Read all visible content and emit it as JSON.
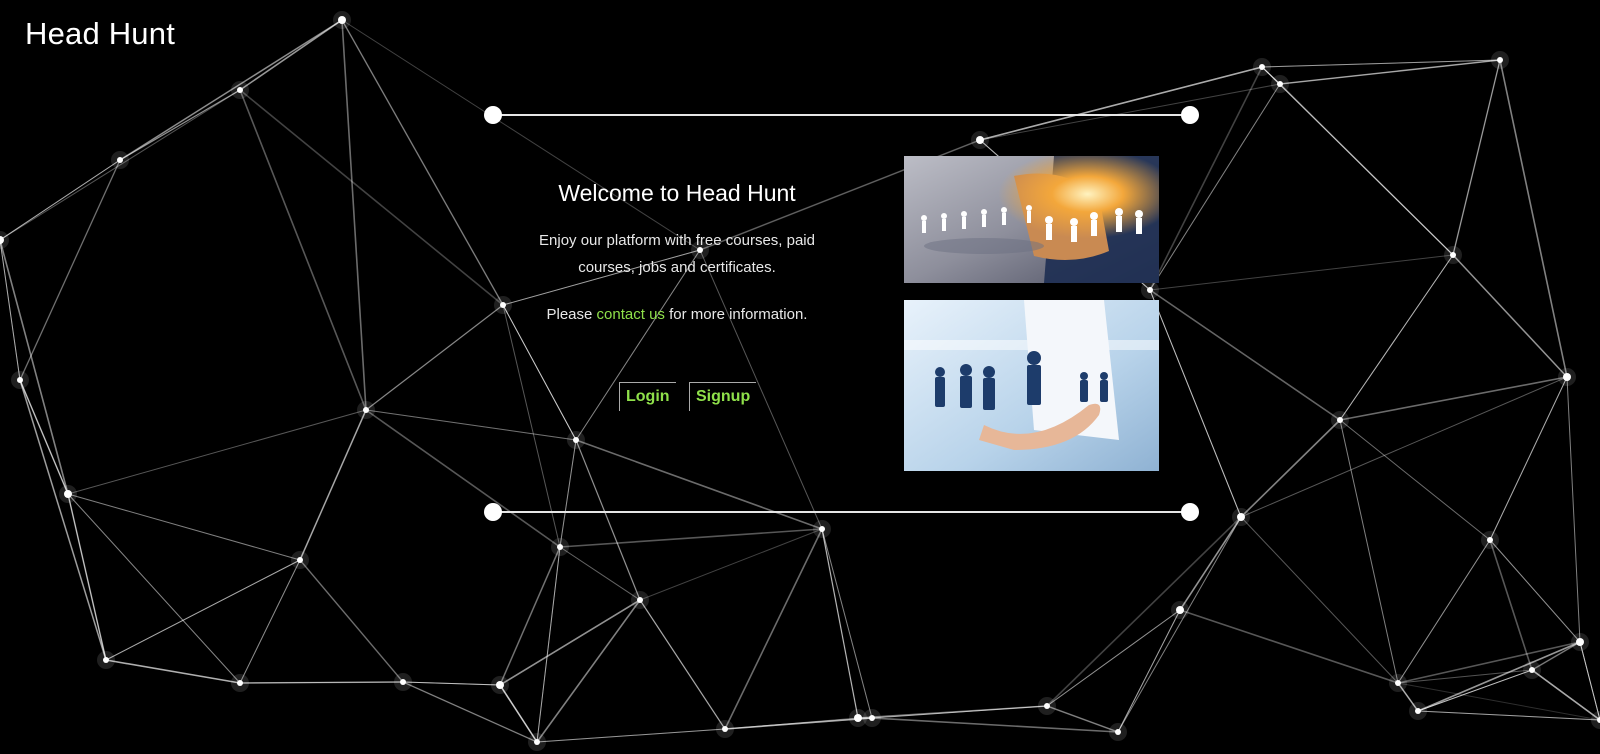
{
  "header": {
    "brand": "Head Hunt"
  },
  "intro": {
    "title": "Welcome to Head Hunt",
    "description": "Enjoy our platform with free courses, paid courses, jobs and certificates.",
    "more_prefix": "Please ",
    "contact_link": "contact us",
    "more_suffix": " for more information."
  },
  "actions": {
    "login": "Login",
    "signup": "Signup"
  },
  "images": [
    {
      "alt": "hand touching network of business people figures"
    },
    {
      "alt": "open hand holding business people figures"
    }
  ],
  "colors": {
    "background": "#000000",
    "accent_green": "#8fe04a",
    "text": "#ffffff"
  }
}
